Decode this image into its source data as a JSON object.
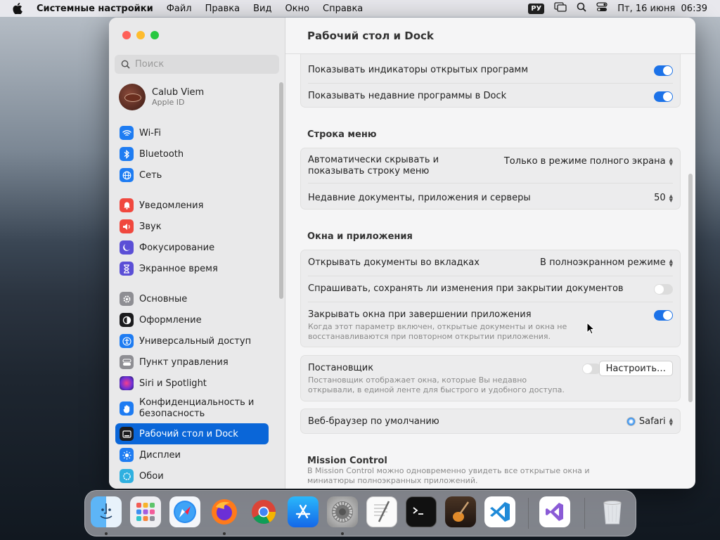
{
  "menubar": {
    "items": [
      "Системные настройки",
      "Файл",
      "Правка",
      "Вид",
      "Окно",
      "Справка"
    ],
    "lang": "РУ",
    "datetime": "Пт, 16 июня  06:39"
  },
  "sidebar": {
    "search_placeholder": "Поиск",
    "profile": {
      "name": "Calub Viem",
      "subtitle": "Apple ID"
    },
    "items": [
      {
        "label": "Wi-Fi",
        "icon": "wifi-icon",
        "color": "#1e7cf2"
      },
      {
        "label": "Bluetooth",
        "icon": "bluetooth-icon",
        "color": "#1e7cf2"
      },
      {
        "label": "Сеть",
        "icon": "globe-icon",
        "color": "#1e7cf2"
      },
      {
        "label": "Уведомления",
        "icon": "bell-icon",
        "color": "#f0483e"
      },
      {
        "label": "Звук",
        "icon": "speaker-icon",
        "color": "#f0483e"
      },
      {
        "label": "Фокусирование",
        "icon": "moon-icon",
        "color": "#5b4fd6"
      },
      {
        "label": "Экранное время",
        "icon": "hourglass-icon",
        "color": "#5b4fd6"
      },
      {
        "label": "Основные",
        "icon": "gear-icon",
        "color": "#8e8e93"
      },
      {
        "label": "Оформление",
        "icon": "appearance-icon",
        "color": "#1c1c1e"
      },
      {
        "label": "Универсальный доступ",
        "icon": "accessibility-icon",
        "color": "#1e7cf2"
      },
      {
        "label": "Пункт управления",
        "icon": "control-center-icon",
        "color": "#8e8e93"
      },
      {
        "label": "Siri и Spotlight",
        "icon": "siri-icon",
        "color": "#8a3dd8"
      },
      {
        "label": "Конфиденциальность и безопасность",
        "icon": "hand-icon",
        "color": "#1e7cf2"
      },
      {
        "label": "Рабочий стол и Dock",
        "icon": "dock-icon",
        "color": "#1c1c1e"
      },
      {
        "label": "Дисплеи",
        "icon": "sun-icon",
        "color": "#1e7cf2"
      },
      {
        "label": "Обои",
        "icon": "wallpaper-icon",
        "color": "#2fb0e0"
      }
    ]
  },
  "content": {
    "title": "Рабочий стол и Dock",
    "dock_group": {
      "show_indicators": "Показывать индикаторы открытых программ",
      "show_recent": "Показывать недавние программы в Dock"
    },
    "menubar_section": {
      "heading": "Строка меню",
      "autohide_label": "Автоматически скрывать и показывать строку меню",
      "autohide_value": "Только в режиме полного экрана",
      "recent_label": "Недавние документы, приложения и серверы",
      "recent_value": "50"
    },
    "windows_section": {
      "heading": "Окна и приложения",
      "tabs_label": "Открывать документы во вкладках",
      "tabs_value": "В полноэкранном режиме",
      "ask_save_label": "Спрашивать, сохранять ли изменения при закрытии документов",
      "close_windows_label": "Закрывать окна при завершении приложения",
      "close_windows_desc": "Когда этот параметр включен, открытые документы и окна не восстанавливаются при повторном открытии приложения."
    },
    "stage_manager": {
      "label": "Постановщик",
      "desc": "Постановщик отображает окна, которые Вы недавно открывали, в единой ленте для быстрого и удобного доступа.",
      "button": "Настроить…"
    },
    "browser": {
      "label": "Веб-браузер по умолчанию",
      "value": "Safari"
    },
    "mission_control": {
      "heading": "Mission Control",
      "desc": "В Mission Control можно одновременно увидеть все открытые окна и миниатюры полноэкранных приложений."
    }
  },
  "dock": {
    "apps": [
      "Finder",
      "Launchpad",
      "Safari",
      "Firefox",
      "Chrome",
      "App Store",
      "System Settings",
      "TextEdit",
      "Terminal",
      "Instruments",
      "VS Code",
      "Visual Studio",
      "Trash"
    ]
  }
}
